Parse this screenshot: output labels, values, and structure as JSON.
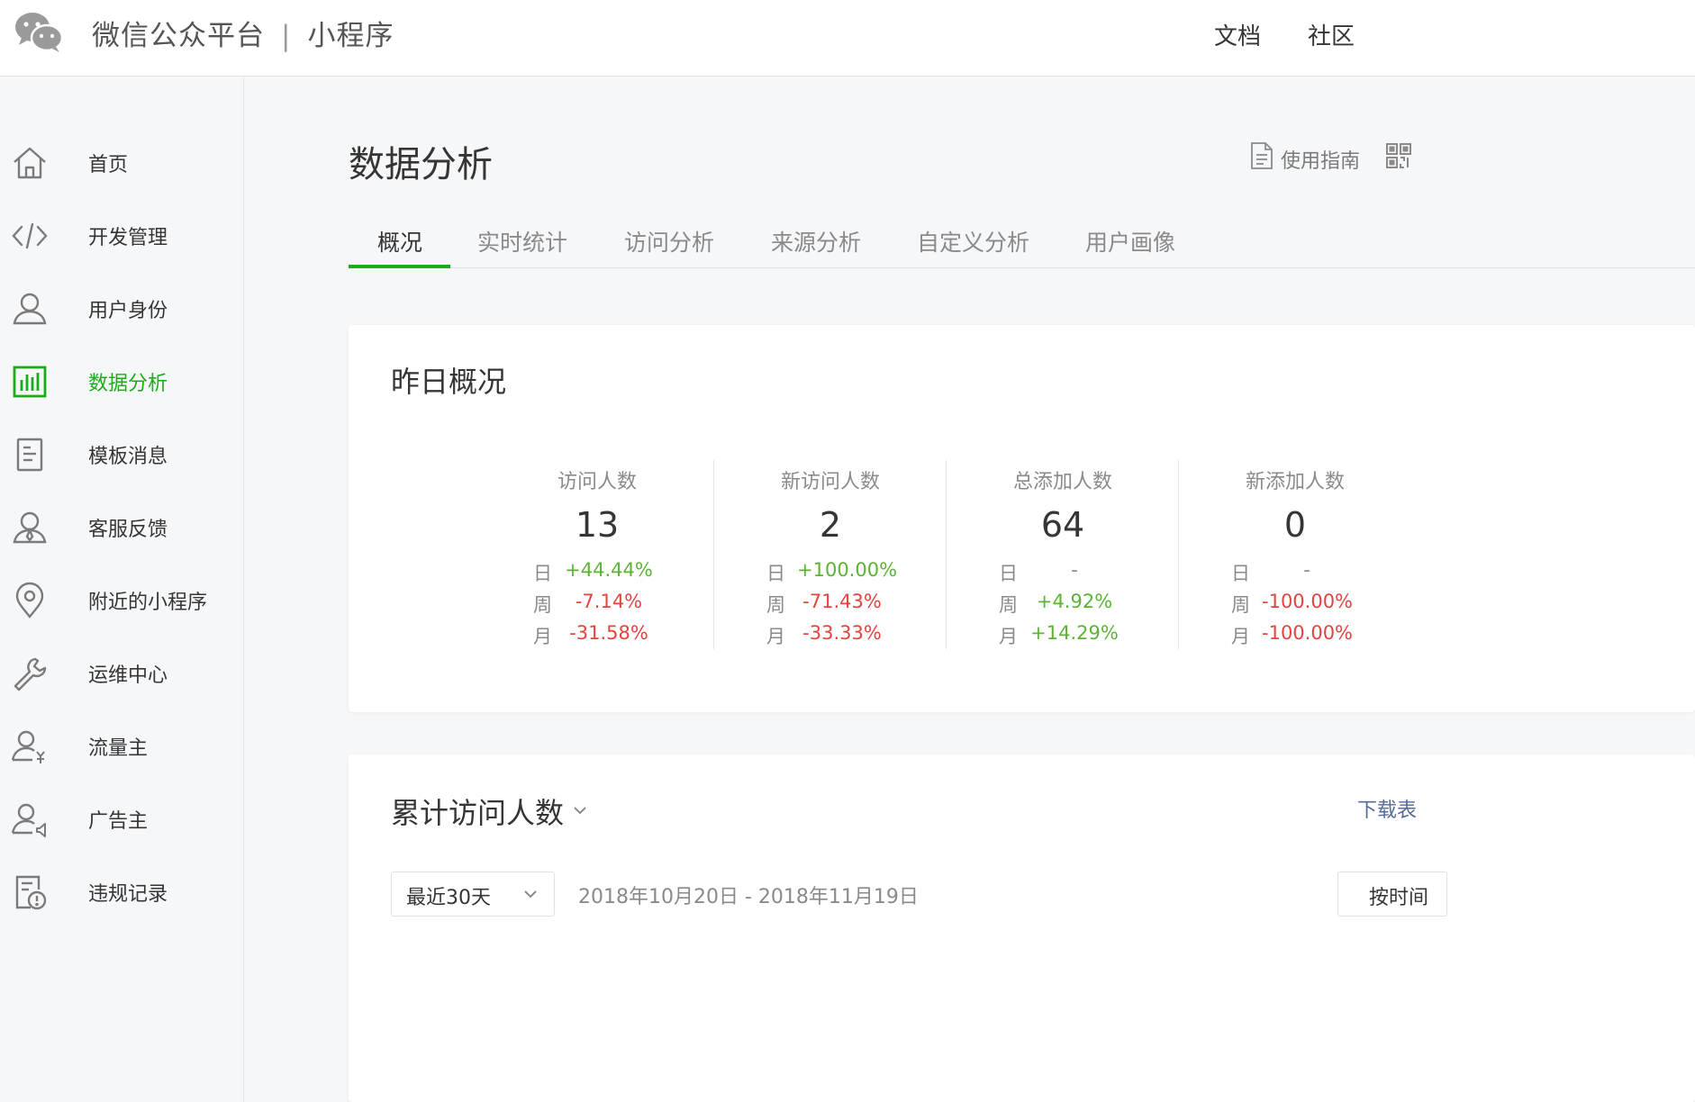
{
  "header": {
    "brand": "微信公众平台",
    "separator": "|",
    "product": "小程序",
    "links": [
      "文档",
      "社区"
    ]
  },
  "sidebar": {
    "items": [
      {
        "label": "首页",
        "icon": "home-icon"
      },
      {
        "label": "开发管理",
        "icon": "code-icon"
      },
      {
        "label": "用户身份",
        "icon": "user-icon"
      },
      {
        "label": "数据分析",
        "icon": "bar-chart-icon",
        "active": true
      },
      {
        "label": "模板消息",
        "icon": "document-icon"
      },
      {
        "label": "客服反馈",
        "icon": "customer-service-icon"
      },
      {
        "label": "附近的小程序",
        "icon": "location-pin-icon"
      },
      {
        "label": "运维中心",
        "icon": "wrench-icon"
      },
      {
        "label": "流量主",
        "icon": "user-yen-icon"
      },
      {
        "label": "广告主",
        "icon": "user-megaphone-icon"
      },
      {
        "label": "违规记录",
        "icon": "violation-record-icon"
      }
    ]
  },
  "main": {
    "title": "数据分析",
    "guide_label": "使用指南",
    "tabs": [
      "概况",
      "实时统计",
      "访问分析",
      "来源分析",
      "自定义分析",
      "用户画像"
    ],
    "active_tab": 0
  },
  "overview": {
    "title": "昨日概况",
    "metrics": [
      {
        "label": "访问人数",
        "value": "13",
        "rows": [
          {
            "period": "日",
            "change": "+44.44%"
          },
          {
            "period": "周",
            "change": "-7.14%"
          },
          {
            "period": "月",
            "change": "-31.58%"
          }
        ]
      },
      {
        "label": "新访问人数",
        "value": "2",
        "rows": [
          {
            "period": "日",
            "change": "+100.00%"
          },
          {
            "period": "周",
            "change": "-71.43%"
          },
          {
            "period": "月",
            "change": "-33.33%"
          }
        ]
      },
      {
        "label": "总添加人数",
        "value": "64",
        "rows": [
          {
            "period": "日",
            "change": "-"
          },
          {
            "period": "周",
            "change": "+4.92%"
          },
          {
            "period": "月",
            "change": "+14.29%"
          }
        ]
      },
      {
        "label": "新添加人数",
        "value": "0",
        "rows": [
          {
            "period": "日",
            "change": "-"
          },
          {
            "period": "周",
            "change": "-100.00%"
          },
          {
            "period": "月",
            "change": "-100.00%"
          }
        ]
      }
    ]
  },
  "trend": {
    "title": "累计访问人数",
    "download_label": "下载表",
    "range_select": "最近30天",
    "date_range": "2018年10月20日 - 2018年11月19日",
    "time_button": "按时间"
  },
  "colors": {
    "accent_green": "#1aad19",
    "positive": "#5cb335",
    "negative": "#e64340",
    "link": "#576b95"
  }
}
